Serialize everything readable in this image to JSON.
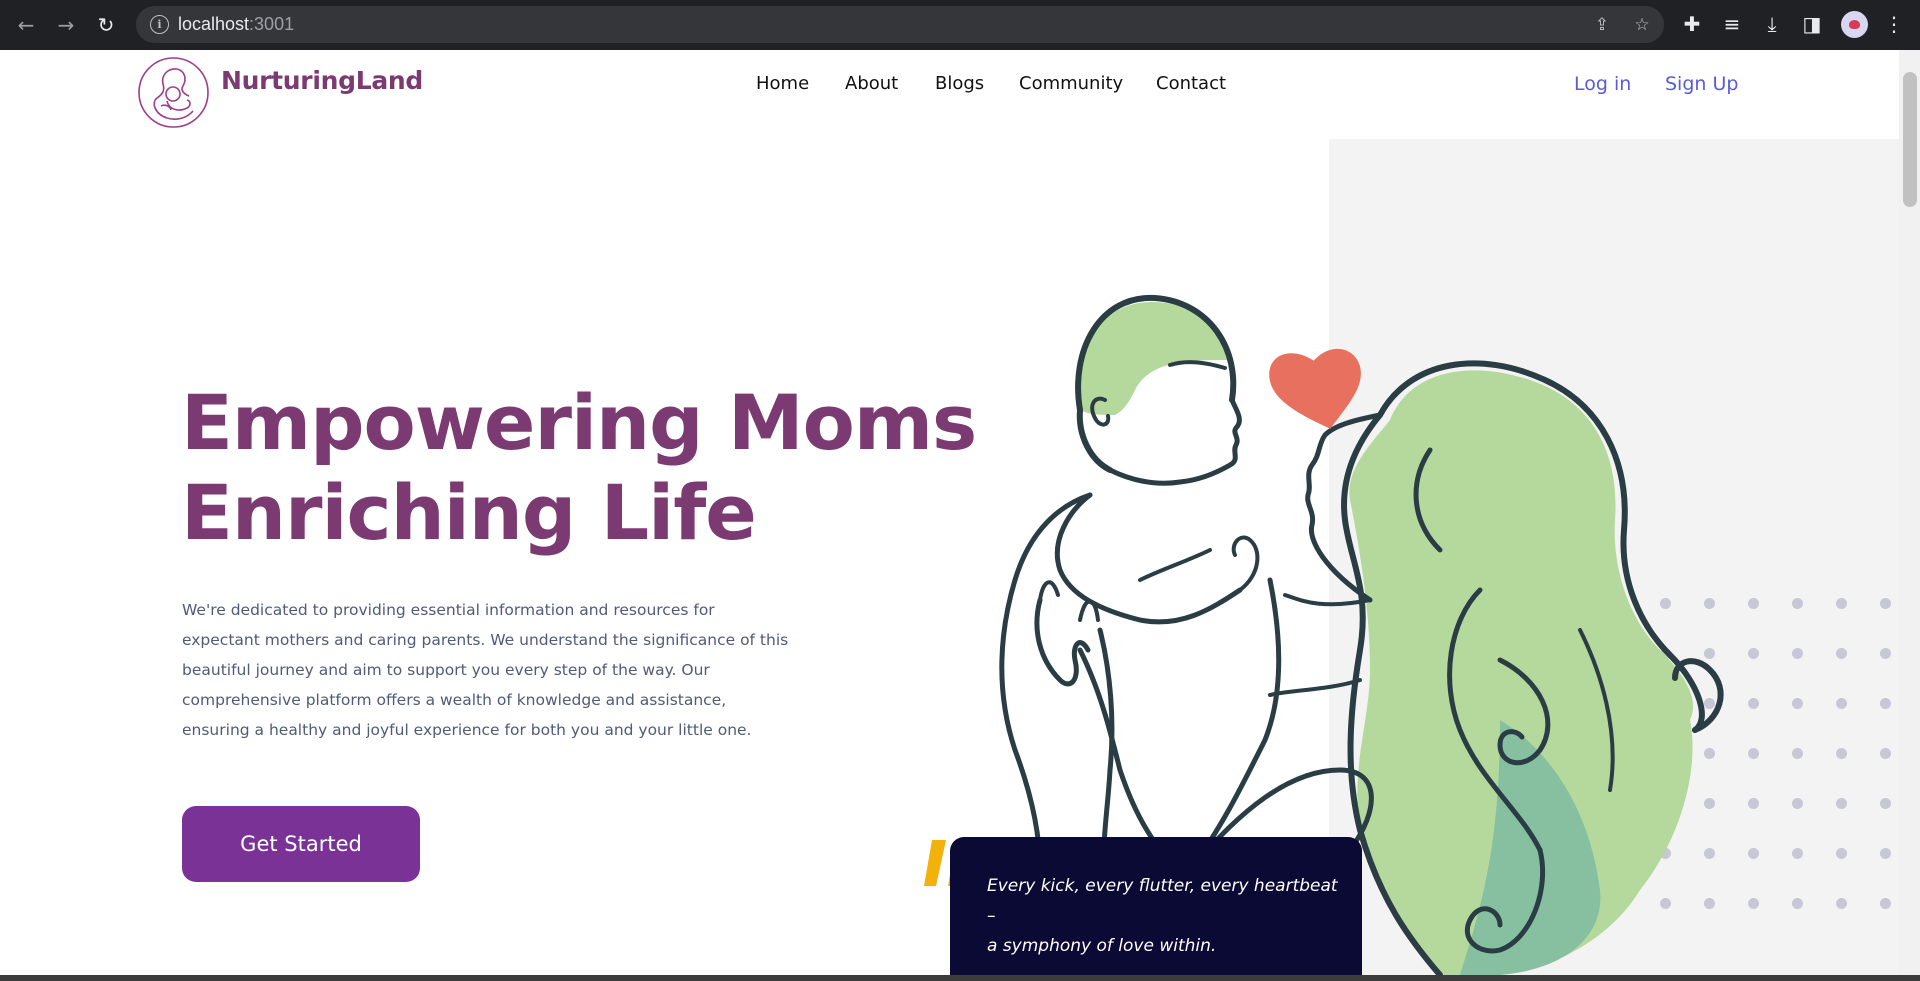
{
  "browser": {
    "url_host": "localhost",
    "url_port": ":3001",
    "icons": [
      "back-icon",
      "forward-icon",
      "reload-icon",
      "info-icon",
      "share-icon",
      "bookmark-star-icon",
      "extensions-puzzle-icon",
      "media-queue-icon",
      "download-icon",
      "side-panel-icon",
      "profile-avatar",
      "menu-kebab-icon"
    ]
  },
  "site": {
    "brand": "NurturingLand",
    "nav": [
      "Home",
      "About",
      "Blogs",
      "Community",
      "Contact"
    ],
    "login": "Log in",
    "signup": "Sign Up"
  },
  "hero": {
    "headline_line1": "Empowering Moms",
    "headline_line2": "Enriching Life",
    "description": "We're dedicated to providing essential information and resources for expectant mothers and caring parents. We understand the significance of this beautiful journey and aim to support you every step of the way. Our comprehensive platform offers a wealth of knowledge and assistance, ensuring a healthy and joyful experience for both you and your little one.",
    "cta": "Get Started"
  },
  "quote": {
    "line1": "Every kick, every flutter, every heartbeat –",
    "line2": "a symphony of love within."
  },
  "colors": {
    "brand_purple": "#7b3a72",
    "button_purple": "#7a3296",
    "link_blue": "#5b5bd6",
    "quote_bg": "#0b0a35",
    "quote_mark": "#f2b10b",
    "heart": "#e8705f",
    "hair_green": "#b5d99c"
  }
}
